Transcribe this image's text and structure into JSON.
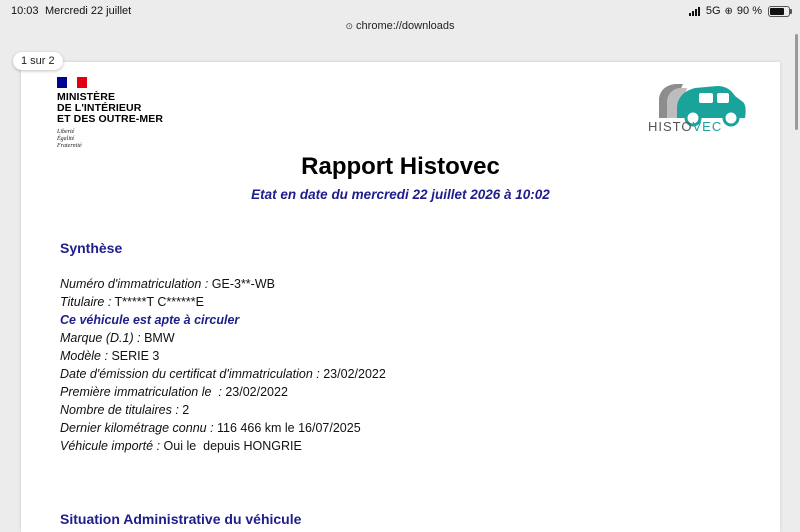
{
  "status_bar": {
    "time": "10:03",
    "date": "Mercredi 22 juillet",
    "network": "5G",
    "battery": "90 %",
    "battery_level": 0.9,
    "icons": [
      "signal-icon",
      "orientation-lock-icon",
      "battery-icon"
    ]
  },
  "browser": {
    "url": "chrome://downloads",
    "page_indicator": "1 sur 2"
  },
  "document": {
    "issuer": {
      "name_lines": [
        "MINISTÈRE",
        "DE L'INTÉRIEUR",
        "ET DES OUTRE-MER"
      ],
      "motto_lines": [
        "Liberté",
        "Égalité",
        "Fraternité"
      ],
      "flag_colors": [
        "#000091",
        "#ffffff",
        "#e1000f"
      ]
    },
    "brand": {
      "part1": "HISTO",
      "part2": "VEC",
      "colors": {
        "primary": "#1aa39a",
        "secondary": "#8d8d8d"
      }
    },
    "title": "Rapport Histovec",
    "subtitle": "Etat en date du mercredi 22 juillet 2026 à 10:02",
    "sections": {
      "synthese": {
        "title": "Synthèse",
        "fields": [
          {
            "label": "Numéro d'immatriculation :",
            "value": "GE-3**-WB"
          },
          {
            "label": "Titulaire :",
            "value": "T*****T C******E"
          },
          {
            "alert": "Ce véhicule est apte à circuler"
          },
          {
            "label": "Marque (D.1) :",
            "value": "BMW"
          },
          {
            "label": "Modèle :",
            "value": "SERIE 3"
          },
          {
            "label": "Date d'émission du certificat d'immatriculation :",
            "value": "23/02/2022"
          },
          {
            "label": "Première immatriculation le  :",
            "value": "23/02/2022"
          },
          {
            "label": "Nombre de titulaires :",
            "value": "2"
          },
          {
            "label": "Dernier kilométrage connu :",
            "value": "116 466 km le 16/07/2025"
          },
          {
            "label": "Véhicule importé :",
            "value": "Oui le  depuis HONGRIE"
          }
        ]
      },
      "situation": {
        "title": "Situation Administrative du véhicule"
      }
    },
    "colors": {
      "heading": "#1d1d8c"
    }
  }
}
